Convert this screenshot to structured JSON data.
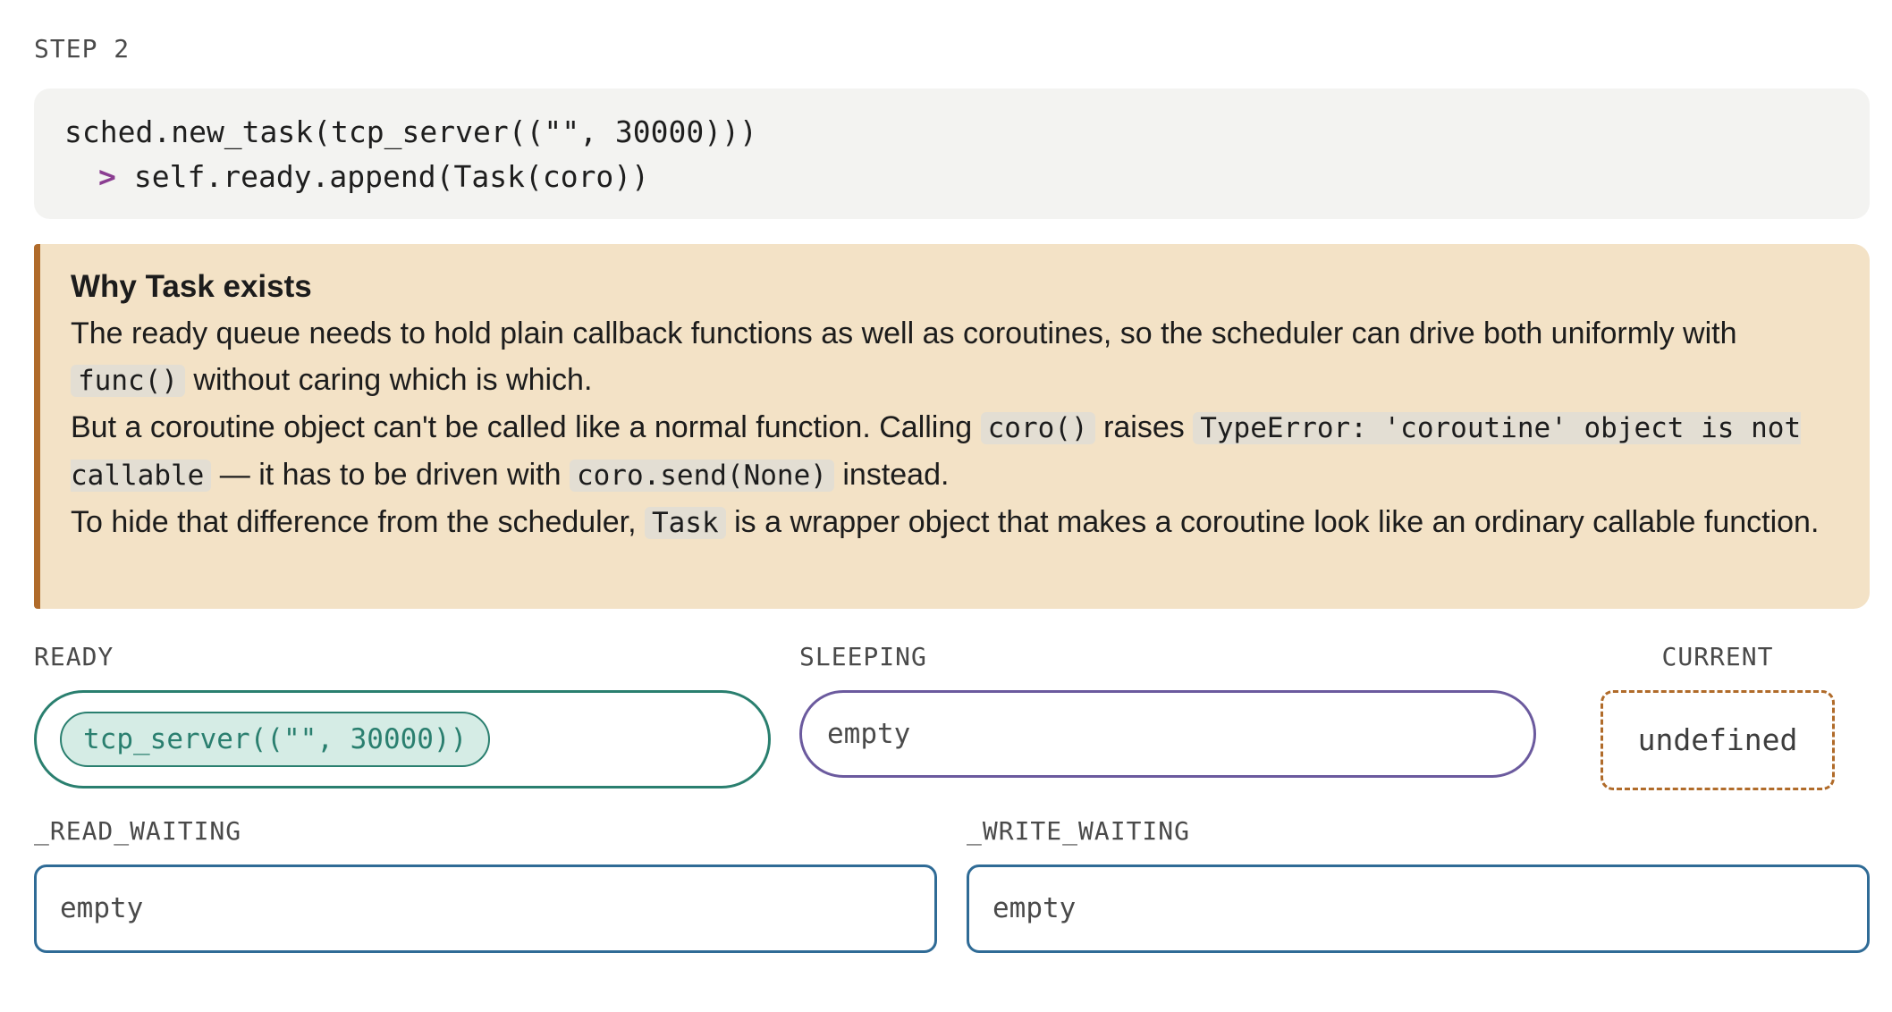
{
  "step": {
    "label": "STEP 2"
  },
  "code": {
    "line1": "sched.new_task(tcp_server((\"\", 30000)))",
    "prompt_glyph": ">",
    "line2": "self.ready.append(Task(coro))"
  },
  "note": {
    "title": "Why Task exists",
    "p1": {
      "text1": "The ready queue needs to hold plain callback functions as well as coroutines, so the scheduler can drive both uniformly with ",
      "code1": "func()",
      "text2": " without caring which is which."
    },
    "p2": {
      "text1": "But a coroutine object can't be called like a normal function. Calling ",
      "code1": "coro()",
      "text2": " raises ",
      "code2": "TypeError: 'coroutine' object is not callable",
      "text3": " — it has to be driven with ",
      "code3": "coro.send(None)",
      "text4": " instead."
    },
    "p3": {
      "text1": "To hide that difference from the scheduler, ",
      "code1": "Task",
      "text2": " is a wrapper object that makes a coroutine look like an ordinary callable function."
    }
  },
  "queues": {
    "ready": {
      "label": "READY",
      "items": [
        "tcp_server((\"\", 30000))"
      ]
    },
    "sleeping": {
      "label": "SLEEPING",
      "empty_text": "empty"
    },
    "current": {
      "label": "CURRENT",
      "value": "undefined"
    },
    "read_waiting": {
      "label": "_READ_WAITING",
      "empty_text": "empty"
    },
    "write_waiting": {
      "label": "_WRITE_WAITING",
      "empty_text": "empty"
    }
  },
  "colors": {
    "ready": "#2a7f6f",
    "sleeping": "#6b5a9e",
    "current": "#b06b2a",
    "waiting": "#2f6b96",
    "note_background": "#f3e2c6"
  }
}
